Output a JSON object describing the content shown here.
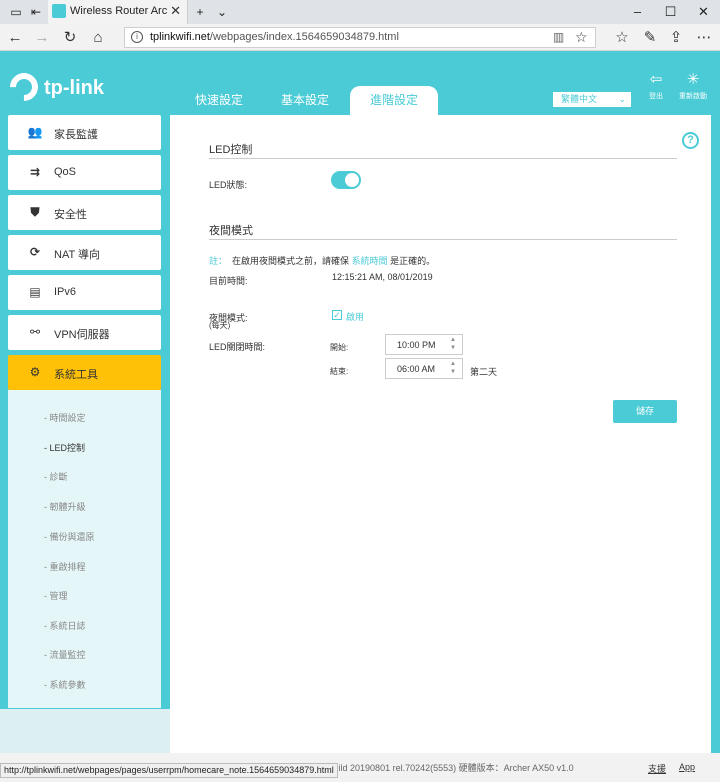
{
  "browser": {
    "tab_title": "Wireless Router Archer A",
    "url_host": "tplinkwifi.net",
    "url_path": "/webpages/index.1564659034879.html",
    "status_url": "http://tplinkwifi.net/webpages/pages/userrpm/homecare_note.1564659034879.html"
  },
  "header": {
    "logo_text": "tp-link",
    "tabs": [
      "快速設定",
      "基本設定",
      "進階設定"
    ],
    "active_tab": "進階設定",
    "language": "繁體中文",
    "logout_label": "登出",
    "reboot_label": "重新啟動"
  },
  "sidebar": {
    "items": [
      {
        "label": "家長監護",
        "icon": "parental-icon"
      },
      {
        "label": "QoS",
        "icon": "qos-icon"
      },
      {
        "label": "安全性",
        "icon": "shield-icon"
      },
      {
        "label": "NAT 導向",
        "icon": "nat-icon"
      },
      {
        "label": "IPv6",
        "icon": "ipv6-icon"
      },
      {
        "label": "VPN伺服器",
        "icon": "vpn-icon"
      },
      {
        "label": "系統工具",
        "icon": "gear-icon"
      }
    ],
    "sub_items": [
      "時間設定",
      "LED控制",
      "診斷",
      "韌體升級",
      "備份與還原",
      "重啟排程",
      "管理",
      "系統日誌",
      "流量監控",
      "系統參數"
    ],
    "active_sub": "LED控制"
  },
  "content": {
    "led_section_title": "LED控制",
    "led_status_label": "LED狀態:",
    "led_on": true,
    "night_section_title": "夜間模式",
    "note_prefix": "註：",
    "note_text": "在啟用夜間模式之前，請確保",
    "note_link": "系統時間",
    "note_suffix": "是正確的。",
    "current_time_label": "目前時間:",
    "current_time_value": "12:15:21 AM, 08/01/2019",
    "night_mode_label": "夜間模式:",
    "night_mode_sub": "(每天)",
    "enable_label": "啟用",
    "led_off_time_label": "LED關閉時間:",
    "start_label": "開始:",
    "start_value": "10:00 PM",
    "end_label": "結束:",
    "end_value": "06:00 AM",
    "next_day_label": "第二天",
    "save_label": "儲存"
  },
  "footer": {
    "firmware_text": "韌體版本：1.0.0 Build 20190801 rel.70242(5553)  硬體版本：Archer AX50 v1.0",
    "support_label": "支援",
    "app_label": "App"
  },
  "colors": {
    "accent": "#4acbd6",
    "active_menu": "#ffc107"
  }
}
